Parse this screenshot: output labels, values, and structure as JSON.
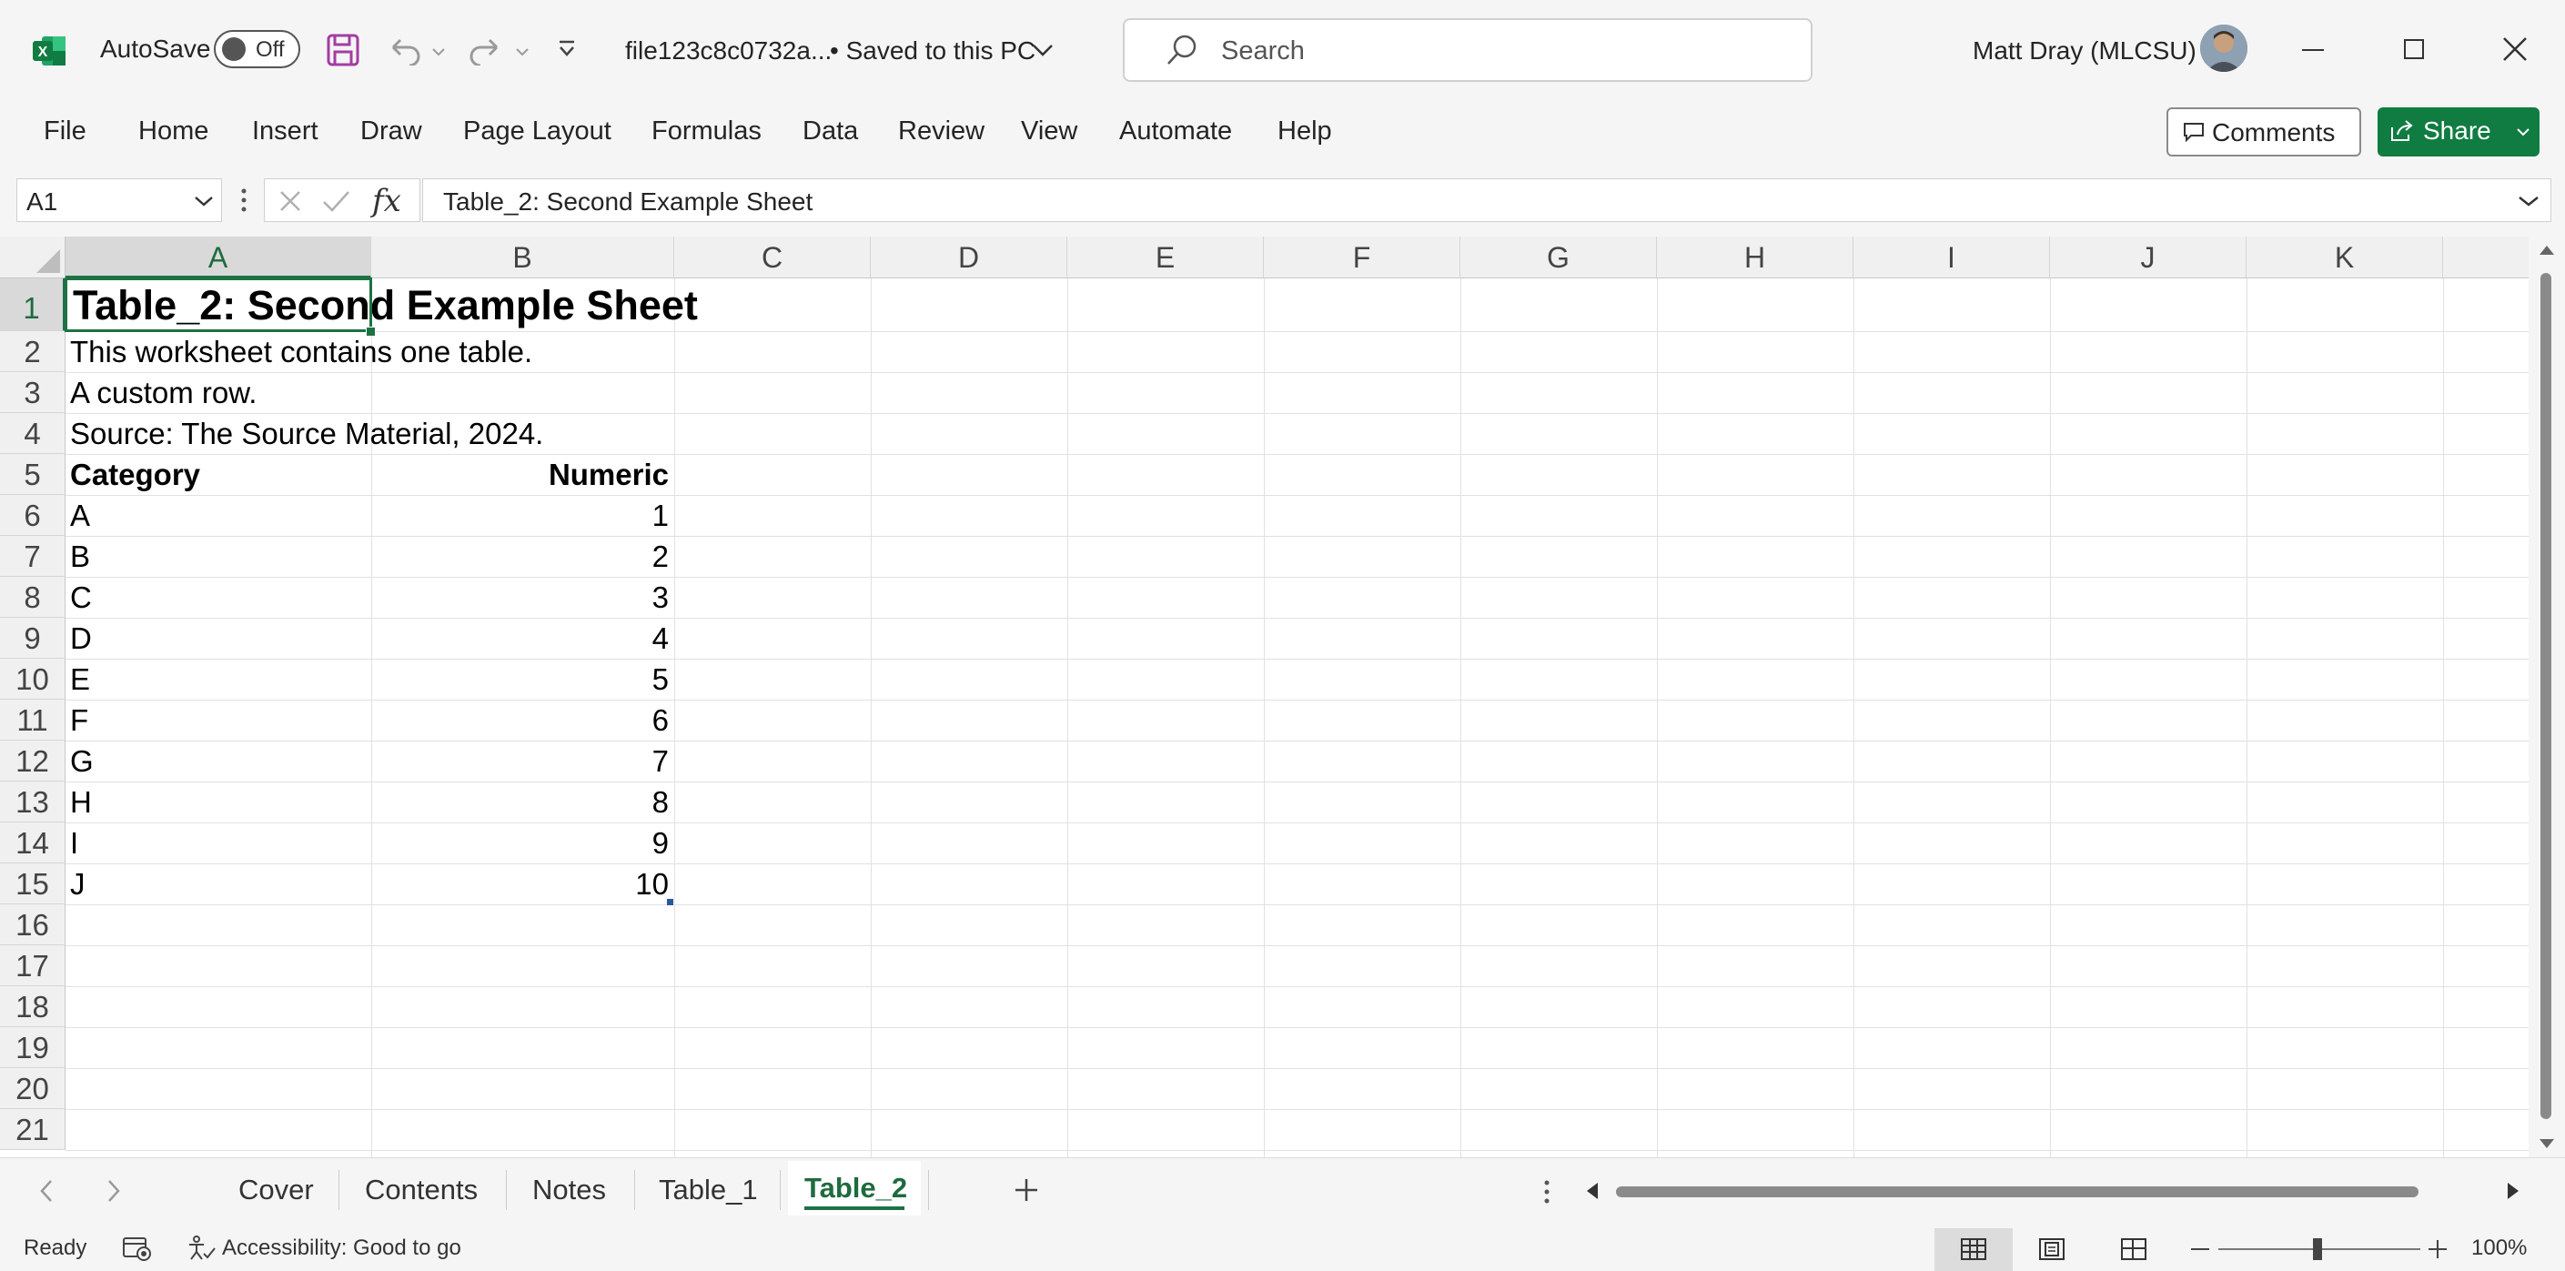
{
  "app": {
    "autosave_label": "AutoSave",
    "autosave_state": "Off",
    "file_name": "file123c8c0732a...",
    "save_status": "• Saved to this PC",
    "search_placeholder": "Search",
    "user_name": "Matt Dray (MLCSU)",
    "brand_color": "#107c41"
  },
  "menu": [
    "File",
    "Home",
    "Insert",
    "Draw",
    "Page Layout",
    "Formulas",
    "Data",
    "Review",
    "View",
    "Automate",
    "Help"
  ],
  "ribbon_buttons": {
    "comments": "Comments",
    "share": "Share"
  },
  "formula_bar": {
    "name_box": "A1",
    "fx": "fx",
    "content": "Table_2: Second Example Sheet"
  },
  "columns": [
    "A",
    "B",
    "C",
    "D",
    "E",
    "F",
    "G",
    "H",
    "I",
    "J",
    "K"
  ],
  "row_numbers": [
    "1",
    "2",
    "3",
    "4",
    "5",
    "6",
    "7",
    "8",
    "9",
    "10",
    "11",
    "12",
    "13",
    "14",
    "15",
    "16",
    "17",
    "18",
    "19",
    "20",
    "21"
  ],
  "sheet": {
    "title": "Table_2: Second Example Sheet",
    "notes": [
      "This worksheet contains one table.",
      "A custom row.",
      "Source: The Source Material, 2024."
    ],
    "table_headers": [
      "Category",
      "Numeric"
    ],
    "table_rows": [
      [
        "A",
        "1"
      ],
      [
        "B",
        "2"
      ],
      [
        "C",
        "3"
      ],
      [
        "D",
        "4"
      ],
      [
        "E",
        "5"
      ],
      [
        "F",
        "6"
      ],
      [
        "G",
        "7"
      ],
      [
        "H",
        "8"
      ],
      [
        "I",
        "9"
      ],
      [
        "J",
        "10"
      ]
    ]
  },
  "tabs": [
    "Cover",
    "Contents",
    "Notes",
    "Table_1",
    "Table_2"
  ],
  "active_tab": "Table_2",
  "status": {
    "ready": "Ready",
    "accessibility": "Accessibility: Good to go",
    "zoom": "100%"
  }
}
